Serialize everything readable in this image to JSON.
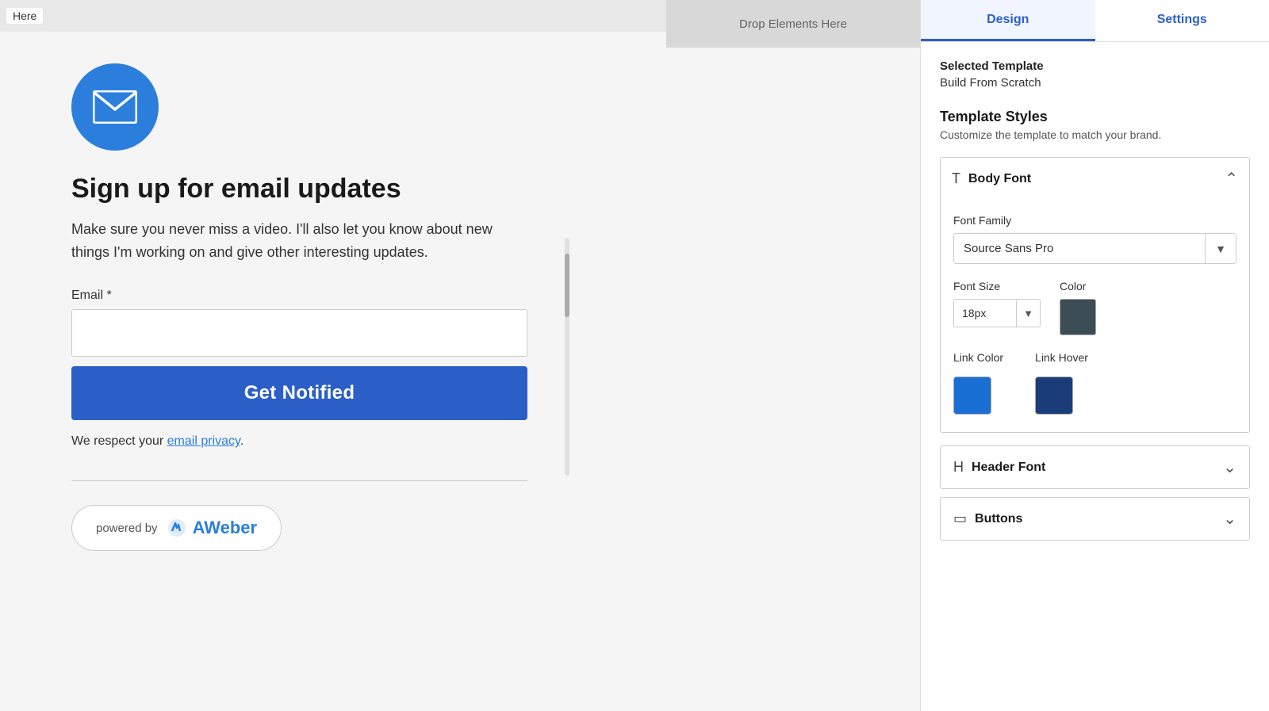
{
  "topbar": {
    "here_label": "Here"
  },
  "dropzone": {
    "label": "Drop Elements Here"
  },
  "form": {
    "icon_alt": "email icon",
    "title": "Sign up for email updates",
    "description": "Make sure you never miss a video. I'll also let you know about new things I'm working on and give other interesting updates.",
    "email_label": "Email *",
    "email_placeholder": "",
    "submit_label": "Get Notified",
    "privacy_text_before": "We respect your ",
    "privacy_link_text": "email privacy",
    "privacy_text_after": ".",
    "powered_by": "powered by",
    "aweber_brand": "AWeber"
  },
  "right_panel": {
    "tab_design": "Design",
    "tab_settings": "Settings",
    "selected_template_label": "Selected Template",
    "selected_template_value": "Build From Scratch",
    "template_styles_title": "Template Styles",
    "template_styles_desc": "Customize the template to match your brand.",
    "body_font_section": {
      "icon": "T",
      "title": "Body Font",
      "is_open": true,
      "font_family_label": "Font Family",
      "font_family_value": "Source Sans Pro",
      "font_size_label": "Font Size",
      "font_size_value": "18px",
      "color_label": "Color",
      "color_hex": "#3d4d55",
      "link_color_label": "Link Color",
      "link_color_hex": "#1a6fd4",
      "link_hover_label": "Link Hover",
      "link_hover_hex": "#1a3d7a"
    },
    "header_font_section": {
      "icon": "H",
      "title": "Header Font",
      "is_open": false
    },
    "buttons_section": {
      "icon": "▭",
      "title": "Buttons",
      "is_open": false
    }
  }
}
